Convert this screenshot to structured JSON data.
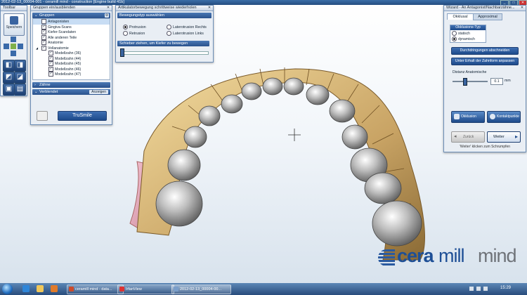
{
  "titlebar": {
    "text": "2012-02-13_00004-001 - ceramill mind - construction [Engine build 41b]"
  },
  "toolbar": {
    "title": "Toolbar",
    "save_label": "Speichern"
  },
  "groups": {
    "title": "Gruppen ein/ausblenden",
    "section": "Gruppen",
    "items": [
      {
        "label": "Antagonisten",
        "checked": false,
        "indent": 1,
        "selected": true
      },
      {
        "label": "Gingiva-Scans",
        "checked": true,
        "indent": 1
      },
      {
        "label": "Kiefer-Scandaten",
        "checked": true,
        "indent": 1
      },
      {
        "label": "Alle anderen Teile",
        "checked": true,
        "indent": 1
      },
      {
        "label": "Anatomie",
        "checked": true,
        "indent": 1
      },
      {
        "label": "Vollanatomie",
        "checked": true,
        "indent": 1
      },
      {
        "label": "Modellzahn (36)",
        "checked": true,
        "indent": 2
      },
      {
        "label": "Modellzahn (44)",
        "checked": true,
        "indent": 2
      },
      {
        "label": "Modellzahn (45)",
        "checked": true,
        "indent": 2
      },
      {
        "label": "Modellzahn (46)",
        "checked": true,
        "indent": 2
      },
      {
        "label": "Modellzahn (47)",
        "checked": true,
        "indent": 2
      }
    ],
    "section_teeth": "Zähne",
    "section_veneer": "Verblendet",
    "veneer_btn": "Anzeigen",
    "trusmile": "TruSmile"
  },
  "articulator": {
    "title": "Artikulatorbewegung schrittweise wiederholen",
    "section1": "Bewegungstyp auswählen",
    "opt_protrusion": "Protrusion",
    "opt_retrusion": "Retrusion",
    "opt_lat_right": "Laterotrusion Rechts",
    "opt_lat_left": "Laterotrusion Links",
    "section2": "Schieber ziehen, um Kiefer zu bewegen"
  },
  "wizard": {
    "title": "Wizard - An Antagonist/Nachbarzähne...",
    "tab1": "Okklusal",
    "tab2": "Approximal",
    "occ_type": "Okklusions-Typ",
    "opt_static": "statisch",
    "opt_dynamic": "dynamisch",
    "btn_through": "Durchdringungen abschneiden",
    "btn_under": "Unter Erhalt der Zahnform anpassen",
    "distance_label": "Distanz Anatomische",
    "distance_value": "0.1",
    "unit": "mm",
    "btn_occlusion": "Okklusion",
    "btn_contact": "Kontaktpunkte",
    "btn_back": "Zurück",
    "btn_next": "Weiter",
    "hint": "'Weiter' klicken zum Schrumpfen"
  },
  "logo": {
    "a": "cera",
    "b": "mill",
    "c": "mind"
  },
  "taskbar": {
    "buttons": [
      "ceramill mind - data...",
      "IrfanView",
      "2012-02-13_00004-00..."
    ],
    "time": "15:29"
  },
  "colors": {
    "accent": "#2a528d",
    "logo_blue": "#1e4f96",
    "logo_grey": "#6f7379"
  }
}
